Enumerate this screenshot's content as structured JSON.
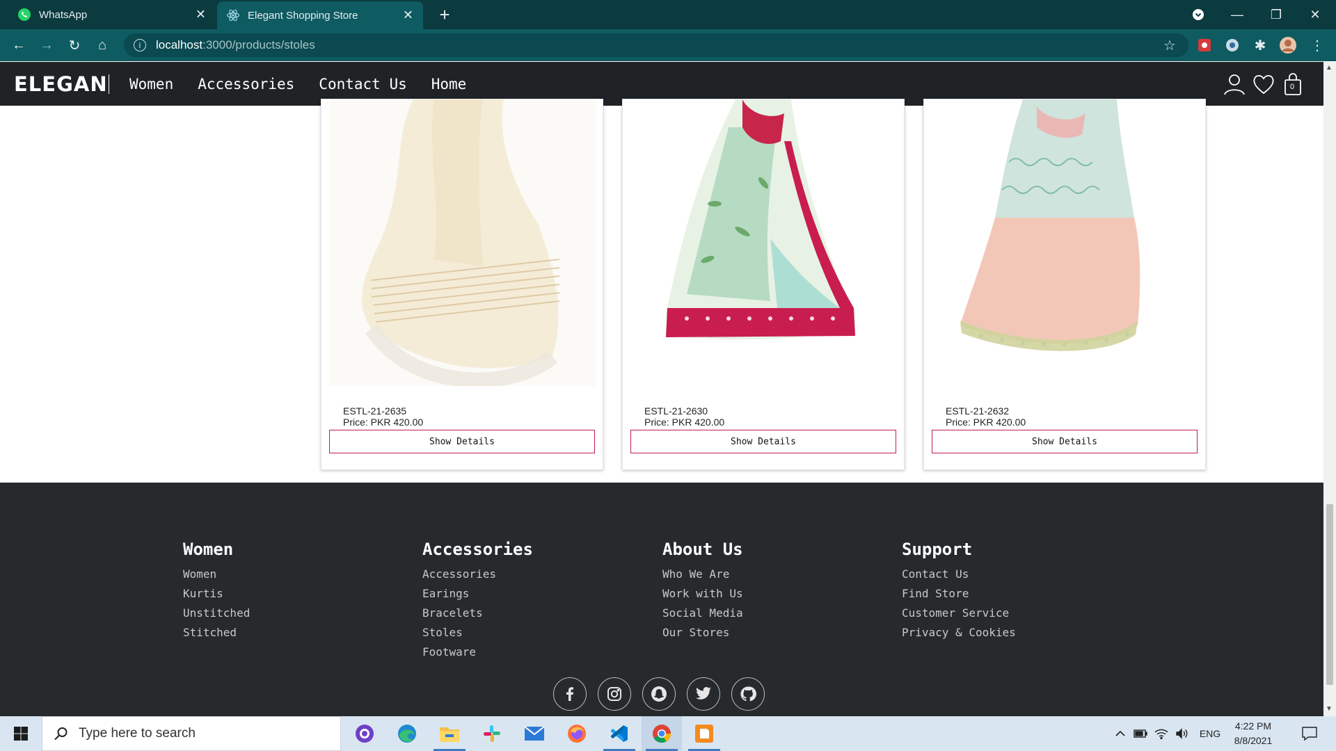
{
  "browser": {
    "tabs": [
      {
        "title": "WhatsApp",
        "icon": "whatsapp-icon"
      },
      {
        "title": "Elegant Shopping Store",
        "icon": "react-icon"
      }
    ],
    "url_host": "localhost",
    "url_path": ":3000/products/stoles"
  },
  "site": {
    "logo_text": "ELEGAN",
    "nav": [
      "Women",
      "Accessories",
      "Contact Us",
      "Home"
    ],
    "cart_count": "0"
  },
  "products": [
    {
      "sku": "ESTL-21-2635",
      "price": "Price: PKR 420.00",
      "button": "Show Details",
      "image": "cream-stole"
    },
    {
      "sku": "ESTL-21-2630",
      "price": "Price: PKR 420.00",
      "button": "Show Details",
      "image": "floral-red-stole"
    },
    {
      "sku": "ESTL-21-2632",
      "price": "Price: PKR 420.00",
      "button": "Show Details",
      "image": "peach-mint-stole"
    }
  ],
  "footer": {
    "columns": [
      {
        "title": "Women",
        "links": [
          "Women",
          "Kurtis",
          "Unstitched",
          "Stitched"
        ]
      },
      {
        "title": "Accessories",
        "links": [
          "Accessories",
          "Earings",
          "Bracelets",
          "Stoles",
          "Footware"
        ]
      },
      {
        "title": "About Us",
        "links": [
          "Who We Are",
          "Work with Us",
          "Social Media",
          "Our Stores"
        ]
      },
      {
        "title": "Support",
        "links": [
          "Contact Us",
          "Find Store",
          "Customer Service",
          "Privacy & Cookies"
        ]
      }
    ],
    "socials": [
      "facebook-icon",
      "instagram-icon",
      "snapchat-icon",
      "twitter-icon",
      "github-icon"
    ]
  },
  "taskbar": {
    "search_placeholder": "Type here to search",
    "language": "ENG",
    "time": "4:22 PM",
    "date": "8/8/2021"
  },
  "colors": {
    "tabbar": "#0b3a3f",
    "toolbar": "#0f5b62",
    "site_header": "#1f2326",
    "footer": "#262a2d",
    "details_border": "#c2185b"
  }
}
